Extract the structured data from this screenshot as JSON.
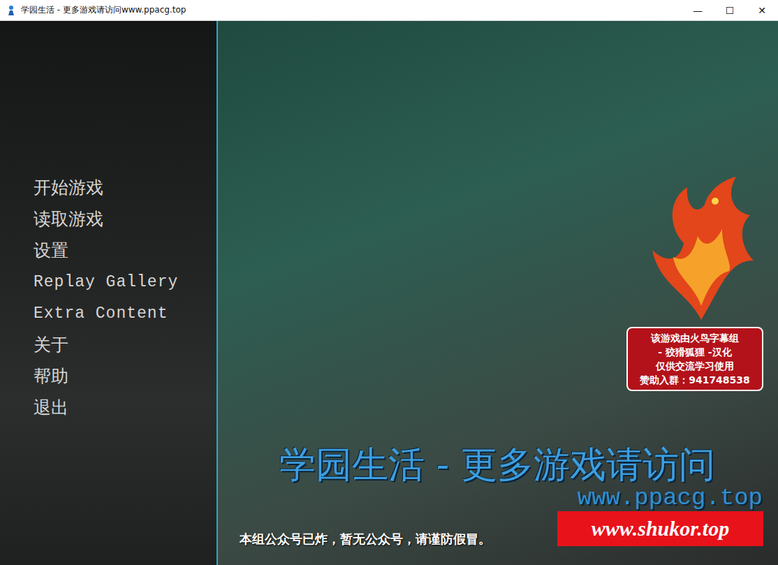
{
  "window": {
    "title": "学园生活 - 更多游戏请访问www.ppacg.top",
    "controls": [
      "—",
      "☐",
      "✕"
    ]
  },
  "menu": [
    {
      "label": "开始游戏",
      "kind": "cjk",
      "selected": false
    },
    {
      "label": "读取游戏",
      "kind": "cjk",
      "selected": false
    },
    {
      "label": "设置",
      "kind": "cjk",
      "selected": false
    },
    {
      "label": "Replay Gallery",
      "kind": "latin",
      "selected": false
    },
    {
      "label": "Extra Content",
      "kind": "latin",
      "selected": false
    },
    {
      "label": "关于",
      "kind": "cjk",
      "selected": false
    },
    {
      "label": "帮助",
      "kind": "cjk",
      "selected": false
    },
    {
      "label": "退出",
      "kind": "cjk",
      "selected": false
    }
  ],
  "overlay": {
    "title": "学园生活 - 更多游戏请访问",
    "site": "www.ppacg.top",
    "badge": [
      "该游戏由火鸟字幕组",
      "- 狡猾狐狸 -汉化",
      "仅供交流学习使用",
      "赞助入群：941748538"
    ],
    "notice": "本组公众号已炸，暂无公众号，请谨防假冒。",
    "stamp": "www.shukor.top"
  }
}
